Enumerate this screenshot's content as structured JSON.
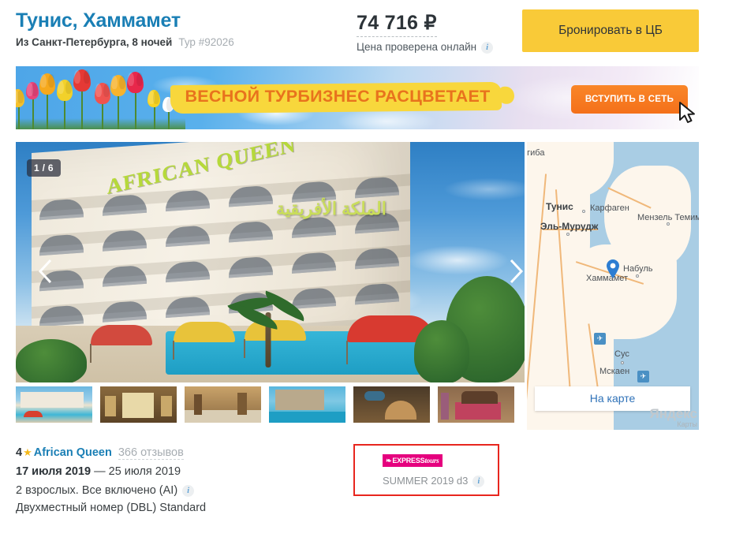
{
  "header": {
    "title": "Тунис, Хаммамет",
    "departure": "Из Санкт-Петербурга, 8 ночей",
    "tour_id": "Тур #92026",
    "price": "74 716 ₽",
    "price_checked": "Цена проверена онлайн",
    "info_icon": "i",
    "book_button": "Бронировать в ЦБ"
  },
  "banner": {
    "headline": "ВЕСНОЙ ТУРБИЗНЕС РАСЦВЕТАЕТ",
    "cta": "ВСТУПИТЬ В СЕТЬ",
    "cursor_icon": "cursor-arrow-icon"
  },
  "gallery": {
    "counter": "1 / 6",
    "hotel_sign": "AFRICAN QUEEN",
    "arabic_sign": "الملكة الأفريقية",
    "prev_icon": "chevron-left-icon",
    "next_icon": "chevron-right-icon",
    "thumbnails": [
      {
        "label": "Фасад отеля и бассейн",
        "selected": true
      },
      {
        "label": "Коридор",
        "selected": false
      },
      {
        "label": "Лобби",
        "selected": false
      },
      {
        "label": "Отель и бассейн вечером",
        "selected": false
      },
      {
        "label": "Ресепшн",
        "selected": false
      },
      {
        "label": "Номер",
        "selected": false
      }
    ]
  },
  "map": {
    "button": "На карте",
    "labels": [
      {
        "text": "огиба",
        "city": false
      },
      {
        "text": "Тунис",
        "city": true
      },
      {
        "text": "Карфаген",
        "city": false
      },
      {
        "text": "Мензель Темим",
        "city": false
      },
      {
        "text": "Эль-Мурудж",
        "city": true
      },
      {
        "text": "Набуль",
        "city": false
      },
      {
        "text": "Хаммамет",
        "city": false
      },
      {
        "text": "Сус",
        "city": false
      },
      {
        "text": "Мскаен",
        "city": false
      }
    ],
    "pin_icon": "map-pin-icon",
    "airport_icon": "airplane-icon",
    "watermark_top": "Яндекс",
    "watermark_bottom": "Карты"
  },
  "details": {
    "stars": "4",
    "star_icon": "★",
    "hotel_name": "African Queen",
    "reviews": "366 отзывов",
    "date_start": "17 июля 2019",
    "date_sep": "—",
    "date_end": "25 июля 2019",
    "occupancy": "2 взрослых. Все включено (AI)",
    "room": "Двухместный номер (DBL) Standard",
    "info_icon": "i"
  },
  "operator": {
    "logo_swirl": "❧",
    "logo_text_bold": "EXPRESS",
    "logo_text_italic": "tours",
    "package": "SUMMER 2019 d3",
    "info_icon": "i",
    "border_color": "#e8261e",
    "logo_bg": "#e5007e"
  }
}
